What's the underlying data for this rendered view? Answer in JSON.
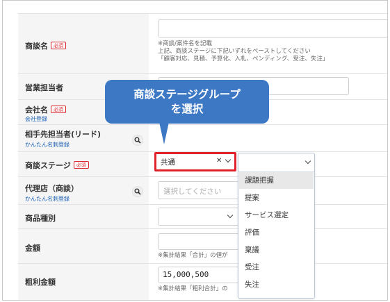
{
  "form": {
    "rows": {
      "deal_name": {
        "label": "商談名",
        "required": "必須",
        "help": [
          "※商談/案件名を記載",
          "上記、商談ステージに下記いずれをペーストしてください",
          "「顧客対応、見積、予算化、入札、ペンディング、受注、失注」"
        ]
      },
      "sales_rep": {
        "label": "営業担当者"
      },
      "company": {
        "label": "会社名",
        "required": "必須",
        "link": "会社登録"
      },
      "contact": {
        "label": "相手先担当者(リード)",
        "link": "かんたん名刺登録"
      },
      "stage": {
        "label": "商談ステージ",
        "required": "必須",
        "value": "共通",
        "clear": "✕"
      },
      "agency": {
        "label": "代理店（商談）",
        "link": "かんたん名刺登録",
        "placeholder": "選択してください"
      },
      "product_type": {
        "label": "商品種別"
      },
      "amount": {
        "label": "金額",
        "help": "※集計結果「合計」の値が"
      },
      "gross_profit": {
        "label": "粗利金額",
        "value": "15,000,500",
        "help": "※集計結果「粗利合計」の"
      }
    }
  },
  "callout": {
    "line1": "商談ステージグループ",
    "line2": "を選択"
  },
  "dropdown": {
    "options": [
      "課題把握",
      "提案",
      "サービス選定",
      "評価",
      "稟議",
      "受注",
      "失注"
    ],
    "highlighted_index": 0
  },
  "colors": {
    "callout": "#3d78c5",
    "highlight_border": "#e0232b",
    "required_badge": "#d9262b",
    "link": "#1a5fb4",
    "label_bg": "#f5f5f5"
  },
  "icons": {
    "search": "magnifier-icon",
    "chevron": "chevron-down-icon",
    "clear": "clear-x-icon"
  }
}
